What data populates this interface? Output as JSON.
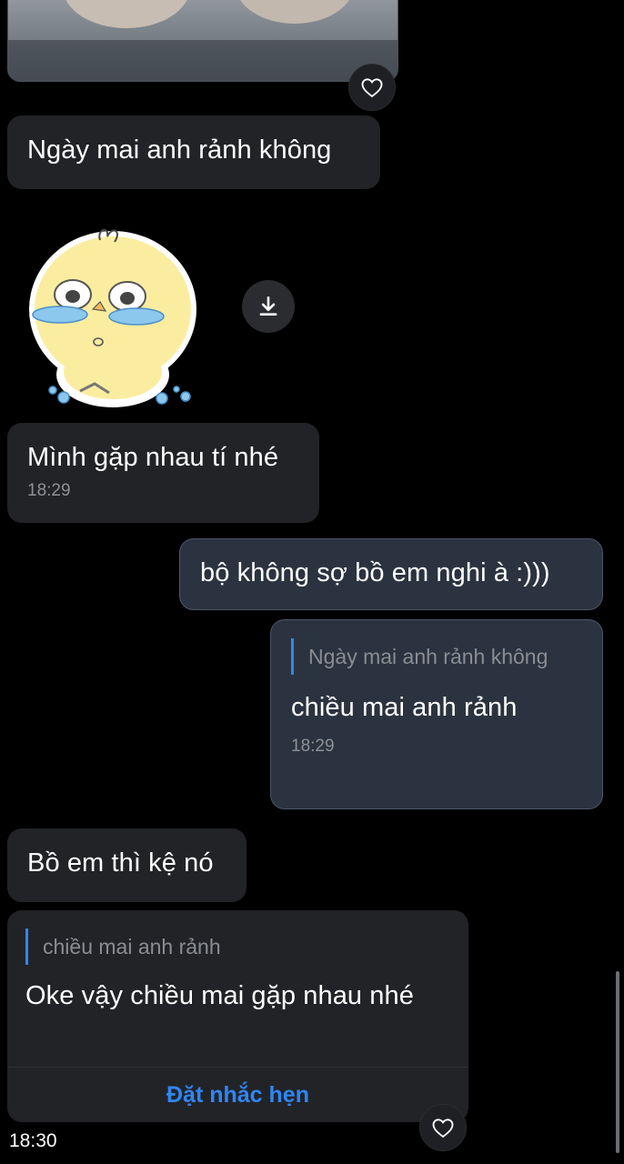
{
  "messages": {
    "m1": {
      "text": "Ngày mai anh rảnh không"
    },
    "m2": {
      "text": "Mình gặp nhau tí nhé",
      "time": "18:29"
    },
    "m3": {
      "text": "bộ không sợ bồ em nghi à :)))"
    },
    "m4": {
      "quote": "Ngày mai anh rảnh không",
      "text": "chiều mai anh rảnh",
      "time": "18:29"
    },
    "m5": {
      "text": "Bồ em thì kệ nó"
    },
    "m6": {
      "quote": "chiều mai anh rảnh",
      "text": "Oke vậy chiều mai gặp nhau nhé",
      "action": "Đặt nhắc hẹn"
    }
  },
  "footer_time": "18:30",
  "icons": {
    "heart": "heart-icon",
    "download": "download-icon",
    "sticker": "crying-chick-sticker"
  },
  "colors": {
    "background": "#000000",
    "incoming_bubble": "#222326",
    "outgoing_bubble": "#2b3340",
    "accent": "#2f86f6"
  }
}
